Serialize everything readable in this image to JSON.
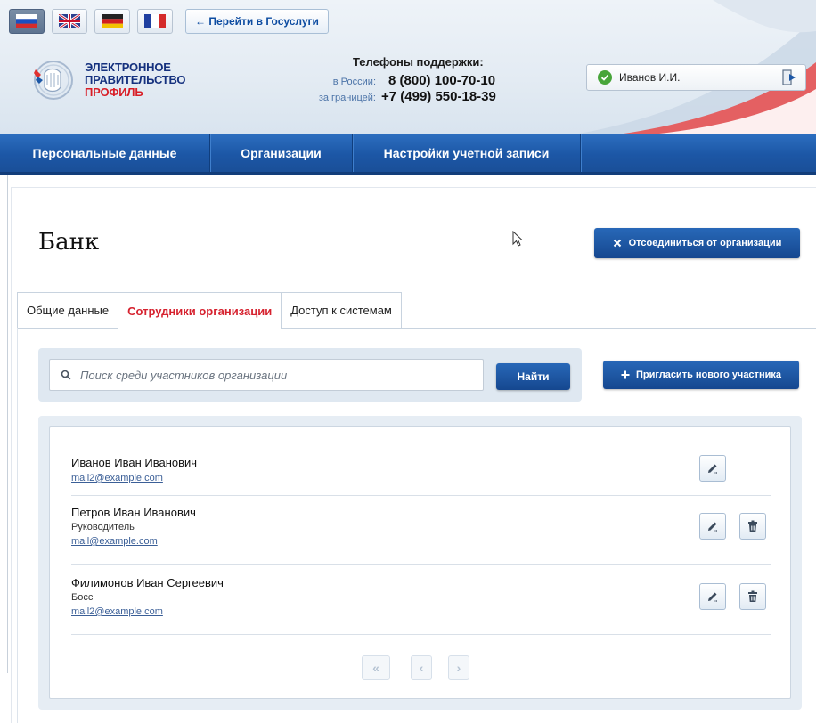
{
  "header": {
    "languages": [
      {
        "name": "russian",
        "active": true
      },
      {
        "name": "english",
        "active": false
      },
      {
        "name": "german",
        "active": false
      },
      {
        "name": "french",
        "active": false
      }
    ],
    "goto_gosuslugi": "← Перейти в Госуслуги",
    "logo": {
      "line1": "ЭЛЕКТРОННОЕ",
      "line2": "ПРАВИТЕЛЬСТВО",
      "line3": "ПРОФИЛЬ"
    },
    "support": {
      "title": "Телефоны поддержки:",
      "russia_label": "в России:",
      "russia_phone": "8 (800) 100-70-10",
      "abroad_label": "за границей:",
      "abroad_phone": "+7 (499) 550-18-39"
    },
    "user": {
      "name": "Иванов И.И.",
      "icon": "check-icon",
      "logout_icon": "logout-icon"
    }
  },
  "nav": {
    "items": [
      "Персональные данные",
      "Организации",
      "Настройки учетной записи"
    ]
  },
  "page": {
    "title": "Банк",
    "disconnect_button": "Отсоединиться от организации",
    "tabs": [
      {
        "label": "Общие данные",
        "active": false
      },
      {
        "label": "Сотрудники организации",
        "active": true
      },
      {
        "label": "Доступ к системам",
        "active": false
      }
    ],
    "search": {
      "placeholder": "Поиск среди участников организации",
      "button": "Найти"
    },
    "invite_button": "Пригласить нового участника",
    "members": [
      {
        "name": "Иванов Иван Иванович",
        "role": "",
        "email": "mail2@example.com",
        "can_delete": false
      },
      {
        "name": "Петров Иван Иванович",
        "role": "Руководитель",
        "email": "mail@example.com",
        "can_delete": true
      },
      {
        "name": "Филимонов Иван Сергеевич",
        "role": "Босс",
        "email": "mail2@example.com",
        "can_delete": true
      }
    ],
    "pager": {
      "first": "«",
      "prev": "‹",
      "next": "›"
    }
  },
  "colors": {
    "primary_blue": "#1c57a6",
    "active_tab_red": "#d6222f",
    "logo_blue": "#15317e",
    "logo_red": "#d81d26",
    "ok_green": "#48a53a"
  }
}
